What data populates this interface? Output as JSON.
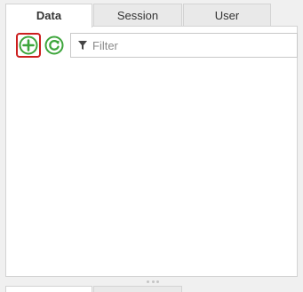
{
  "tabs": [
    {
      "label": "Data",
      "active": true
    },
    {
      "label": "Session",
      "active": false
    },
    {
      "label": "User",
      "active": false
    }
  ],
  "toolbar": {
    "add_icon": "plus-circle-icon",
    "refresh_icon": "refresh-icon",
    "filter_icon": "funnel-icon",
    "filter_placeholder": "Filter",
    "filter_value": ""
  },
  "colors": {
    "icon_green": "#3da53b",
    "highlight_red": "#cc1f1f"
  }
}
